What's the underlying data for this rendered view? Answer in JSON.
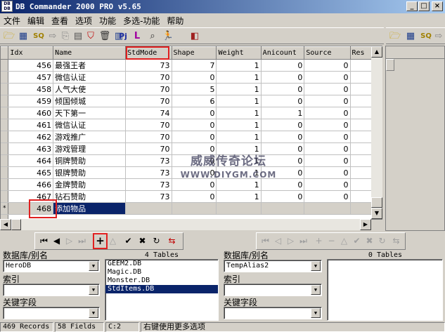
{
  "title": "DB Commander 2000 PRO v5.65",
  "icons": {
    "app": "app-icon",
    "min": "minimize-icon",
    "max": "maximize-icon",
    "close": "close-icon"
  },
  "menu": [
    "文件",
    "编辑",
    "查看",
    "选项",
    "功能",
    "多选-功能",
    "帮助"
  ],
  "grid": {
    "columns": [
      "Idx",
      "Name",
      "StdMode",
      "Shape",
      "Weight",
      "Anicount",
      "Source",
      "Res"
    ],
    "rows": [
      {
        "idx": "456",
        "name": "最强王者",
        "stdmode": "73",
        "shape": "7",
        "weight": "1",
        "anicount": "0",
        "source": "0"
      },
      {
        "idx": "457",
        "name": "微信认证",
        "stdmode": "70",
        "shape": "0",
        "weight": "1",
        "anicount": "0",
        "source": "0"
      },
      {
        "idx": "458",
        "name": "人气大使",
        "stdmode": "70",
        "shape": "5",
        "weight": "1",
        "anicount": "0",
        "source": "0"
      },
      {
        "idx": "459",
        "name": "倾国倾城",
        "stdmode": "70",
        "shape": "6",
        "weight": "1",
        "anicount": "0",
        "source": "0"
      },
      {
        "idx": "460",
        "name": "天下第一",
        "stdmode": "74",
        "shape": "0",
        "weight": "1",
        "anicount": "1",
        "source": "0"
      },
      {
        "idx": "461",
        "name": "微信认证",
        "stdmode": "70",
        "shape": "0",
        "weight": "1",
        "anicount": "0",
        "source": "0"
      },
      {
        "idx": "462",
        "name": "游戏推广",
        "stdmode": "70",
        "shape": "0",
        "weight": "1",
        "anicount": "0",
        "source": "0"
      },
      {
        "idx": "463",
        "name": "游戏管理",
        "stdmode": "70",
        "shape": "0",
        "weight": "1",
        "anicount": "0",
        "source": "0"
      },
      {
        "idx": "464",
        "name": "铜牌赞助",
        "stdmode": "73",
        "shape": "0",
        "weight": "1",
        "anicount": "0",
        "source": "0"
      },
      {
        "idx": "465",
        "name": "银牌赞助",
        "stdmode": "73",
        "shape": "0",
        "weight": "1",
        "anicount": "0",
        "source": "0"
      },
      {
        "idx": "466",
        "name": "金牌赞助",
        "stdmode": "73",
        "shape": "0",
        "weight": "1",
        "anicount": "0",
        "source": "0"
      },
      {
        "idx": "467",
        "name": "钻石赞助",
        "stdmode": "73",
        "shape": "0",
        "weight": "1",
        "anicount": "0",
        "source": "0"
      }
    ],
    "new_row": {
      "marker": "*",
      "idx": "468",
      "name": "添加物品"
    }
  },
  "watermark": {
    "line1": "威威传奇论坛",
    "line2": "WWW.DIYGM.COM"
  },
  "left_panel": {
    "tables_count": "4 Tables",
    "db_label": "数据库/别名",
    "db_value": "HeroDB",
    "index_label": "索引",
    "key_label": "关键字段",
    "tables": [
      "GEEM2.DB",
      "Magic.DB",
      "Monster.DB",
      "StdItems.DB"
    ],
    "selected_table": 3
  },
  "right_panel": {
    "tables_count": "0 Tables",
    "db_label": "数据库/别名",
    "db_value": "TempAlias2",
    "index_label": "索引",
    "key_label": "关键字段"
  },
  "status": {
    "records": "469 Records",
    "fields": "58 Fields",
    "col": "C:2",
    "hint": "右键使用更多选项"
  }
}
